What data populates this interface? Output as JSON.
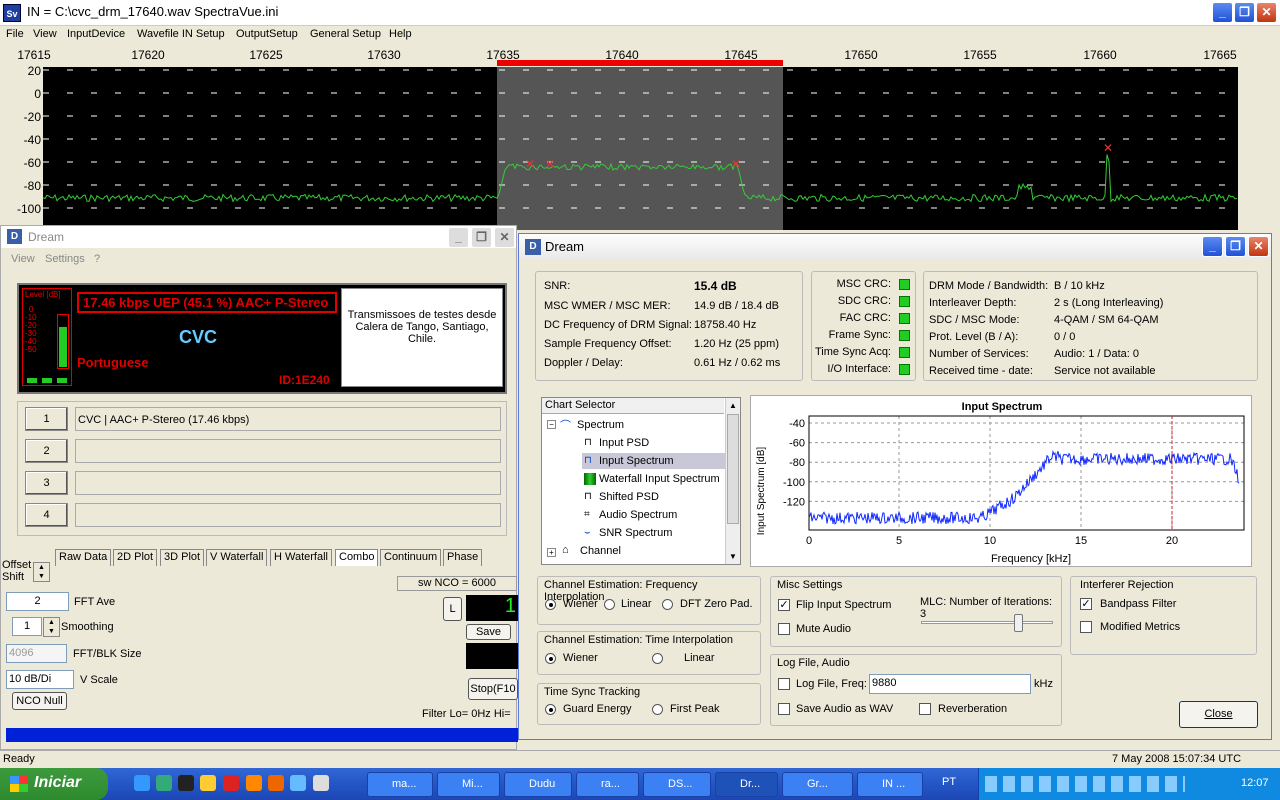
{
  "main_window": {
    "icon_text": "Sv",
    "title": "IN = C:\\cvc_drm_17640.wav    SpectraVue.ini",
    "menu": [
      "File",
      "View",
      "InputDevice",
      "Wavefile IN Setup",
      "OutputSetup",
      "General Setup",
      "Help"
    ]
  },
  "spectrum": {
    "freq_ticks": [
      "17615",
      "17620",
      "17625",
      "17630",
      "17635",
      "17640",
      "17645",
      "17650",
      "17655",
      "17660",
      "17665"
    ],
    "db_ticks": [
      "20",
      "0",
      "-20",
      "-40",
      "-60",
      "-80",
      "-100"
    ]
  },
  "dream_small": {
    "title": "Dream",
    "menu": [
      "View",
      "Settings",
      "?"
    ],
    "level_label": "Level [dB]",
    "level_ticks": [
      "0",
      "-10",
      "-20",
      "-30",
      "-40",
      "-50"
    ],
    "rate": "17.46 kbps UEP (45.1 %) AAC+ P-Stereo",
    "station": "CVC",
    "language": "Portuguese",
    "sid": "ID:1E240",
    "text_message": "Transmissoes de testes desde Calera de Tango, Santiago, Chile.",
    "services": [
      {
        "num": "1",
        "label": "CVC  |   AAC+ P-Stereo (17.46 kbps)"
      },
      {
        "num": "2",
        "label": ""
      },
      {
        "num": "3",
        "label": ""
      },
      {
        "num": "4",
        "label": ""
      }
    ]
  },
  "spectravue_controls": {
    "offset_label": "Offset",
    "shift_label": "Shift",
    "tabs": [
      "Raw Data",
      "2D Plot",
      "3D Plot",
      "V Waterfall",
      "H Waterfall",
      "Combo",
      "Continuum",
      "Phase"
    ],
    "fft_ave_value": "2",
    "fft_ave_label": "FFT Ave",
    "smoothing_value": "1",
    "smoothing_label": "Smoothing",
    "fft_size_value": "4096",
    "fft_size_label": "FFT/BLK Size",
    "vscale_value": "10 dB/Di",
    "vscale_label": "V Scale",
    "nco_null": "NCO Null",
    "sw_nco": "sw NCO = 6000",
    "l_button": "L",
    "big_digit": "1",
    "save": "Save",
    "stop": "Stop(F10",
    "filter_label": "Filter  Lo= 0Hz  Hi="
  },
  "dream_big": {
    "title": "Dream",
    "status": {
      "snr_label": "SNR:",
      "snr_value": "15.4 dB",
      "wmer_label": "MSC WMER / MSC MER:",
      "wmer_value": "14.9 dB / 18.4 dB",
      "dcfreq_label": "DC Frequency of DRM Signal:",
      "dcfreq_value": "18758.40 Hz",
      "sfo_label": "Sample Frequency Offset:",
      "sfo_value": "1.20 Hz (25 ppm)",
      "doppler_label": "Doppler / Delay:",
      "doppler_value": "0.61 Hz / 0.62 ms"
    },
    "crc": [
      "MSC CRC:",
      "SDC CRC:",
      "FAC CRC:",
      "Frame Sync:",
      "Time Sync Acq:",
      "I/O Interface:"
    ],
    "mode": {
      "mode_label": "DRM Mode / Bandwidth:",
      "mode_value": "B / 10 kHz",
      "interleaver_label": "Interleaver Depth:",
      "interleaver_value": "2 s (Long Interleaving)",
      "qam_label": "SDC / MSC Mode:",
      "qam_value": "4-QAM / SM 64-QAM",
      "prot_label": "Prot. Level (B / A):",
      "prot_value": "0 / 0",
      "services_label": "Number of Services:",
      "services_value": "Audio: 1 / Data: 0",
      "time_label": "Received time - date:",
      "time_value": "Service not available"
    },
    "chart_selector": {
      "header": "Chart Selector",
      "items": [
        "Spectrum",
        "Input PSD",
        "Input Spectrum",
        "Waterfall Input Spectrum",
        "Shifted PSD",
        "Audio Spectrum",
        "SNR Spectrum",
        "Channel"
      ]
    },
    "chart": {
      "title": "Input Spectrum",
      "ylabel": "Input Spectrum [dB]",
      "xlabel": "Frequency [kHz]",
      "yticks": [
        "-40",
        "-60",
        "-80",
        "-100",
        "-120"
      ],
      "xticks": [
        "0",
        "5",
        "10",
        "15",
        "20"
      ]
    },
    "freq_interp": {
      "title": "Channel Estimation: Frequency Interpolation",
      "options": [
        "Wiener",
        "Linear",
        "DFT Zero Pad."
      ]
    },
    "time_interp": {
      "title": "Channel Estimation: Time Interpolation",
      "options": [
        "Wiener",
        "Linear"
      ]
    },
    "time_sync": {
      "title": "Time Sync Tracking",
      "options": [
        "Guard Energy",
        "First Peak"
      ]
    },
    "misc": {
      "title": "Misc Settings",
      "flip": "Flip Input Spectrum",
      "mute": "Mute Audio",
      "mlc": "MLC: Number of Iterations: 3"
    },
    "log": {
      "title": "Log File, Audio",
      "log_label": "Log File, Freq:",
      "freq_value": "9880",
      "khz": "kHz",
      "save_wav": "Save Audio as WAV",
      "reverb": "Reverberation"
    },
    "interferer": {
      "title": "Interferer Rejection",
      "bandpass": "Bandpass Filter",
      "modified": "Modified Metrics"
    },
    "close": "Close"
  },
  "status_bar": {
    "left": "Ready",
    "right": "7 May 2008  15:07:34 UTC"
  },
  "taskbar": {
    "start": "Iniciar",
    "tasks": [
      "ma...",
      "Mi...",
      "Dudu",
      "ra...",
      "DS...",
      "Dr...",
      "Gr...",
      "IN ..."
    ],
    "lang": "PT",
    "clock": "12:07"
  }
}
